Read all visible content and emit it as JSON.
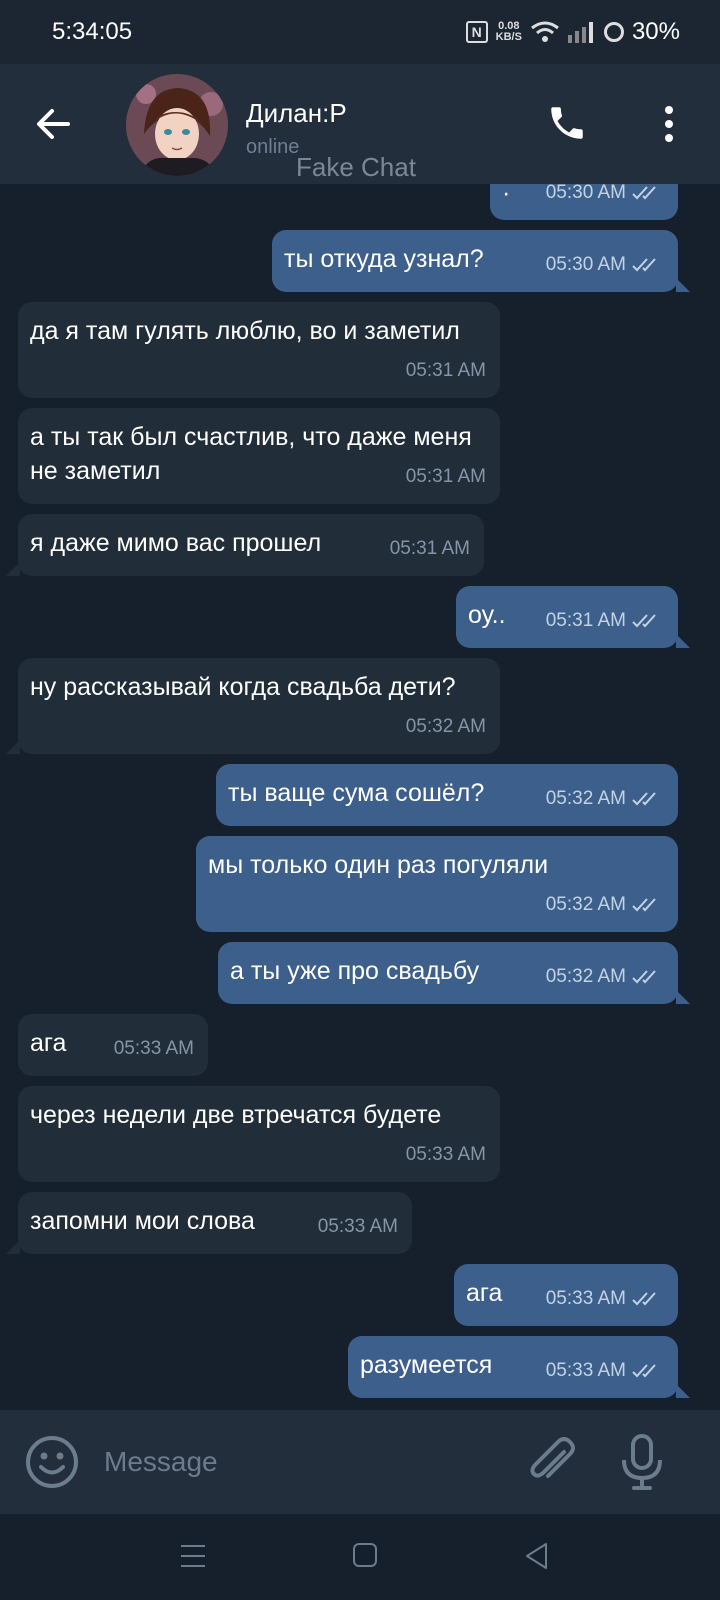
{
  "status_bar": {
    "time": "5:34:05",
    "net_speed_value": "0.08",
    "net_speed_unit": "KB/S",
    "battery": "30%",
    "icons": [
      "nfc-icon",
      "wifi-icon",
      "signal-icon",
      "battery-icon"
    ]
  },
  "header": {
    "name": "Дилан:Р",
    "status": "online",
    "watermark": "Fake Chat",
    "icons": [
      "back-arrow-icon",
      "phone-icon",
      "more-vertical-icon"
    ]
  },
  "messages": [
    {
      "dir": "out",
      "text": "·",
      "time": "05:30 AM"
    },
    {
      "dir": "out",
      "text": "ты откуда узнал?",
      "time": "05:30 AM"
    },
    {
      "dir": "in",
      "text": "да я там гулять люблю, во и заметил",
      "time": "05:31 AM"
    },
    {
      "dir": "in",
      "text": "а ты так был счастлив, что даже меня не заметил",
      "time": "05:31 AM"
    },
    {
      "dir": "in",
      "text": "я даже мимо вас прошел",
      "time": "05:31 AM"
    },
    {
      "dir": "out",
      "text": "оу..",
      "time": "05:31 AM"
    },
    {
      "dir": "in",
      "text": "ну рассказывай когда свадьба дети?",
      "time": "05:32 AM"
    },
    {
      "dir": "out",
      "text": "ты ваще сума сошёл?",
      "time": "05:32 AM"
    },
    {
      "dir": "out",
      "text": "мы только один раз погуляли",
      "time": "05:32 AM"
    },
    {
      "dir": "out",
      "text": "а ты уже про свадьбу",
      "time": "05:32 AM"
    },
    {
      "dir": "in",
      "text": "ага",
      "time": "05:33 AM"
    },
    {
      "dir": "in",
      "text": "через недели две втречатся будете",
      "time": "05:33 AM"
    },
    {
      "dir": "in",
      "text": "запомни мои слова",
      "time": "05:33 AM"
    },
    {
      "dir": "out",
      "text": "ага",
      "time": "05:33 AM"
    },
    {
      "dir": "out",
      "text": "разумеется",
      "time": "05:33 AM"
    }
  ],
  "composer": {
    "placeholder": "Message",
    "value": "",
    "icons": [
      "emoji-icon",
      "paperclip-icon",
      "microphone-icon"
    ]
  },
  "colors": {
    "background": "#16202c",
    "header": "#222e3c",
    "incoming_bubble": "#222d3a",
    "outgoing_bubble": "#3d5f8b"
  }
}
